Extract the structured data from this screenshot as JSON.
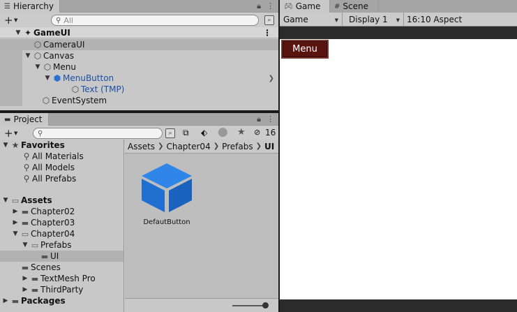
{
  "hierarchy": {
    "tab_label": "Hierarchy",
    "search_placeholder": "All",
    "scene_name": "GameUI",
    "items": [
      {
        "label": "CameraUI"
      },
      {
        "label": "Canvas"
      },
      {
        "label": "Menu"
      },
      {
        "label": "MenuButton"
      },
      {
        "label": "Text (TMP)"
      },
      {
        "label": "EventSystem"
      }
    ]
  },
  "game": {
    "tabs": [
      {
        "label": "Game"
      },
      {
        "label": "Scene"
      }
    ],
    "selectors": [
      {
        "label": "Game"
      },
      {
        "label": "Display 1"
      },
      {
        "label": "16:10 Aspect"
      }
    ],
    "menu_button_label": "Menu"
  },
  "project": {
    "tab_label": "Project",
    "hidden_count": "16",
    "favorites": {
      "label": "Favorites",
      "items": [
        {
          "label": "All Materials"
        },
        {
          "label": "All Models"
        },
        {
          "label": "All Prefabs"
        }
      ]
    },
    "assets": {
      "label": "Assets",
      "items": [
        {
          "label": "Chapter02"
        },
        {
          "label": "Chapter03"
        },
        {
          "label": "Chapter04"
        },
        {
          "label": "Prefabs"
        },
        {
          "label": "UI"
        },
        {
          "label": "Scenes"
        },
        {
          "label": "TextMesh Pro"
        },
        {
          "label": "ThirdParty"
        }
      ]
    },
    "packages_label": "Packages",
    "breadcrumb": [
      {
        "label": "Assets"
      },
      {
        "label": "Chapter04"
      },
      {
        "label": "Prefabs"
      },
      {
        "label": "UI"
      }
    ],
    "assets_shown": [
      {
        "label": "DefautButton"
      }
    ]
  },
  "colors": {
    "menu_button_bg": "#5a1410",
    "prefab_blue": "#1f6fd1",
    "panel_bg": "#c8c8c8"
  }
}
